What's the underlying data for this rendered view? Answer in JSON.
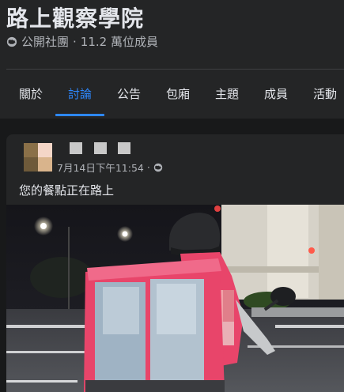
{
  "group": {
    "title": "路上觀察學院",
    "privacy": "公開社團",
    "members": "11.2 萬位成員"
  },
  "tabs": [
    {
      "label": "關於"
    },
    {
      "label": "討論",
      "active": true
    },
    {
      "label": "公告"
    },
    {
      "label": "包廂"
    },
    {
      "label": "主題"
    },
    {
      "label": "成員"
    },
    {
      "label": "活動"
    }
  ],
  "post": {
    "timestamp": "7月14日下午11:54",
    "separator": "·",
    "privacy_icon": "globe-icon",
    "text": "您的餐點正在路上"
  },
  "colors": {
    "accent": "#2d88ff",
    "delivery_bag": "#e8456a"
  }
}
